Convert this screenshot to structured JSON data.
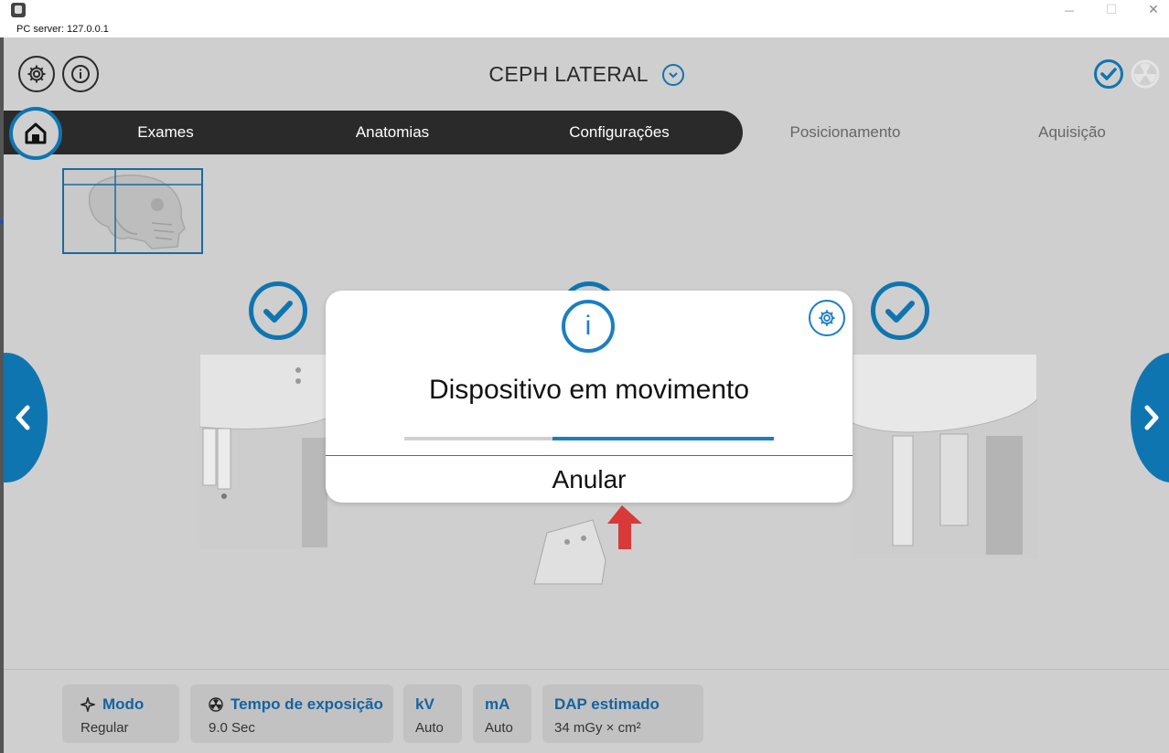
{
  "window": {
    "server_label": "PC server: 127.0.0.1",
    "minimize_glyph": "—",
    "maximize_glyph": "☐",
    "close_glyph": "✕"
  },
  "header": {
    "exam_title": "CEPH LATERAL",
    "settings_icon": "gear-icon",
    "info_icon": "info-icon",
    "status_ok_icon": "check-circle-icon",
    "radiation_icon": "radiation-icon"
  },
  "nav": {
    "home_icon": "home-icon",
    "tabs": [
      {
        "label": "Exames",
        "active": true
      },
      {
        "label": "Anatomias",
        "active": true
      },
      {
        "label": "Configurações",
        "active": true
      },
      {
        "label": "Posicionamento",
        "active": false
      },
      {
        "label": "Aquisição",
        "active": false
      }
    ]
  },
  "modal": {
    "icon_text": "i",
    "message": "Dispositivo em movimento",
    "progress": 0.6,
    "cancel_label": "Anular"
  },
  "params": [
    {
      "title": "Modo",
      "value": "Regular",
      "icon": "sparkle-icon"
    },
    {
      "title": "Tempo de exposição",
      "value": "9.0 Sec",
      "icon": "radiation-icon"
    },
    {
      "title": "kV",
      "value": "Auto"
    },
    {
      "title": "mA",
      "value": "Auto"
    },
    {
      "title": "DAP estimado",
      "value": "34 mGy × cm²"
    }
  ],
  "colors": {
    "accent": "#0f75b0",
    "nav_dark": "#2a2a2a",
    "background": "#cfcfcf",
    "arrow_red": "#d83a3a"
  }
}
